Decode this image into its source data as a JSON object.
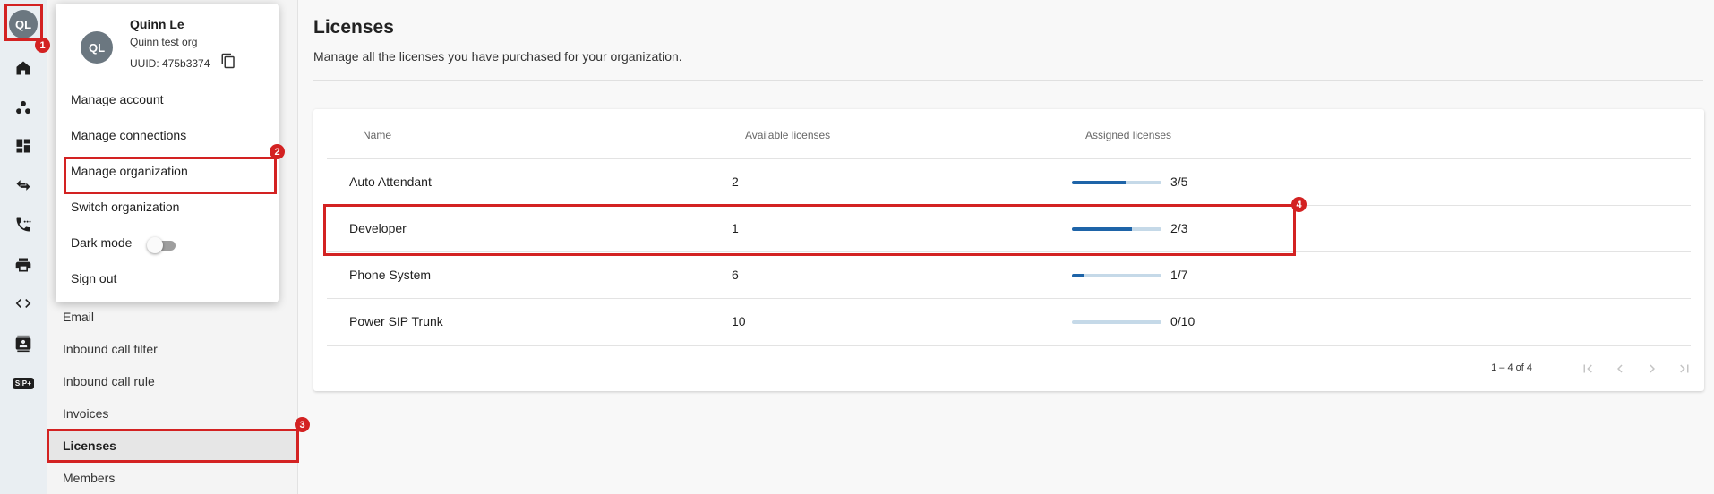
{
  "user": {
    "initials": "QL",
    "name": "Quinn Le",
    "org": "Quinn test org",
    "uuid_label": "UUID: 475b3374"
  },
  "rail": {
    "icons": [
      "home-icon",
      "teams-icon",
      "dashboard-icon",
      "transfer-icon",
      "phone-icon",
      "printer-icon",
      "code-icon",
      "contacts-icon",
      "sip-trunk-icon"
    ],
    "sip_label": "SIP+"
  },
  "popover": {
    "items": [
      "Manage account",
      "Manage connections",
      "Manage organization",
      "Switch organization",
      "Dark mode",
      "Sign out"
    ],
    "dark_mode_on": false
  },
  "submenu": {
    "items": [
      "Email",
      "Inbound call filter",
      "Inbound call rule",
      "Invoices",
      "Licenses",
      "Members"
    ],
    "active": "Licenses"
  },
  "page": {
    "title": "Licenses",
    "description": "Manage all the licenses you have purchased for your organization."
  },
  "table": {
    "headers": [
      "Name",
      "Available licenses",
      "Assigned licenses"
    ],
    "rows": [
      {
        "name": "Auto Attendant",
        "available": "2",
        "assigned": "3/5",
        "fill": 0.6
      },
      {
        "name": "Developer",
        "available": "1",
        "assigned": "2/3",
        "fill": 0.667
      },
      {
        "name": "Phone System",
        "available": "6",
        "assigned": "1/7",
        "fill": 0.143
      },
      {
        "name": "Power SIP Trunk",
        "available": "10",
        "assigned": "0/10",
        "fill": 0
      }
    ]
  },
  "pagination": {
    "info": "1 – 4 of 4"
  },
  "annotations": [
    "1",
    "2",
    "3",
    "4"
  ],
  "colors": {
    "accent": "#1e64a8",
    "highlight": "#d32222",
    "avatar": "#6b7780"
  }
}
